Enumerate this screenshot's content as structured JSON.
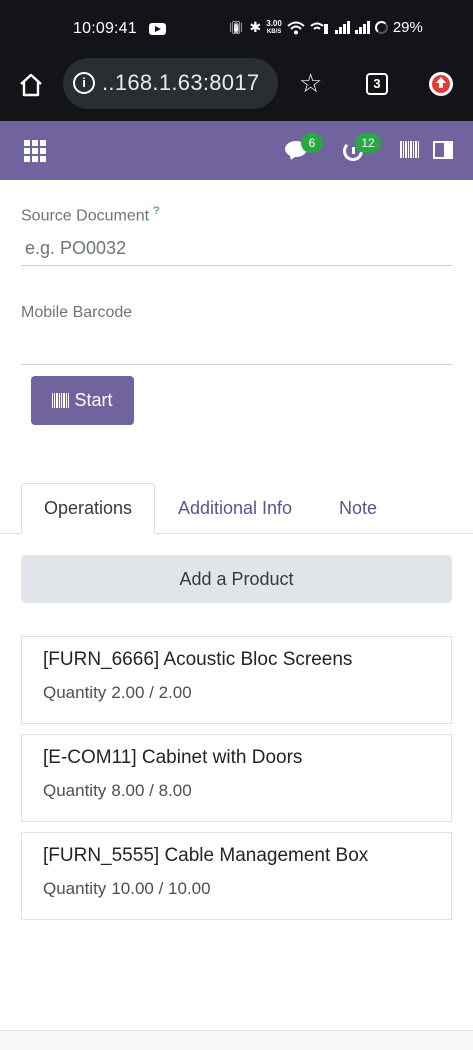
{
  "status_bar": {
    "time": "10:09:41",
    "network_speed": "3.00",
    "network_speed_unit": "KB/S",
    "battery": "29%"
  },
  "browser": {
    "url": "..168.1.63:8017",
    "tab_count": "3"
  },
  "odoo_bar": {
    "messages_count": "6",
    "activities_count": "12"
  },
  "form": {
    "source_document": {
      "label": "Source Document",
      "help": "?",
      "placeholder": "e.g. PO0032",
      "value": ""
    },
    "mobile_barcode": {
      "label": "Mobile Barcode",
      "value": ""
    },
    "start_button": "Start"
  },
  "tabs": [
    {
      "label": "Operations",
      "active": true
    },
    {
      "label": "Additional Info",
      "active": false
    },
    {
      "label": "Note",
      "active": false
    }
  ],
  "operations": {
    "add_product_label": "Add a Product",
    "quantity_label": "Quantity",
    "items": [
      {
        "name": "[FURN_6666] Acoustic Bloc Screens",
        "quantity": "2.00 / 2.00"
      },
      {
        "name": "[E-COM11] Cabinet with Doors",
        "quantity": "8.00 / 8.00"
      },
      {
        "name": "[FURN_5555] Cable Management Box",
        "quantity": "10.00 / 10.00"
      }
    ]
  },
  "icons": {
    "status_bar": [
      "youtube-icon",
      "vibrate-icon",
      "bluetooth-icon",
      "wifi-icon",
      "wifi-calling-icon",
      "signal-icon",
      "signal-icon",
      "battery-icon"
    ],
    "browser": [
      "home-icon",
      "info-icon",
      "star-icon",
      "tabs-icon",
      "update-icon"
    ],
    "odoo_bar": [
      "apps-icon",
      "chat-icon",
      "clock-icon",
      "barcode-icon",
      "sidebar-toggle-icon"
    ]
  },
  "colors": {
    "odoo_primary": "#71639e",
    "badge_green": "#28a745",
    "status_bar_bg": "#121417",
    "add_product_bg": "#e1e4e9"
  }
}
